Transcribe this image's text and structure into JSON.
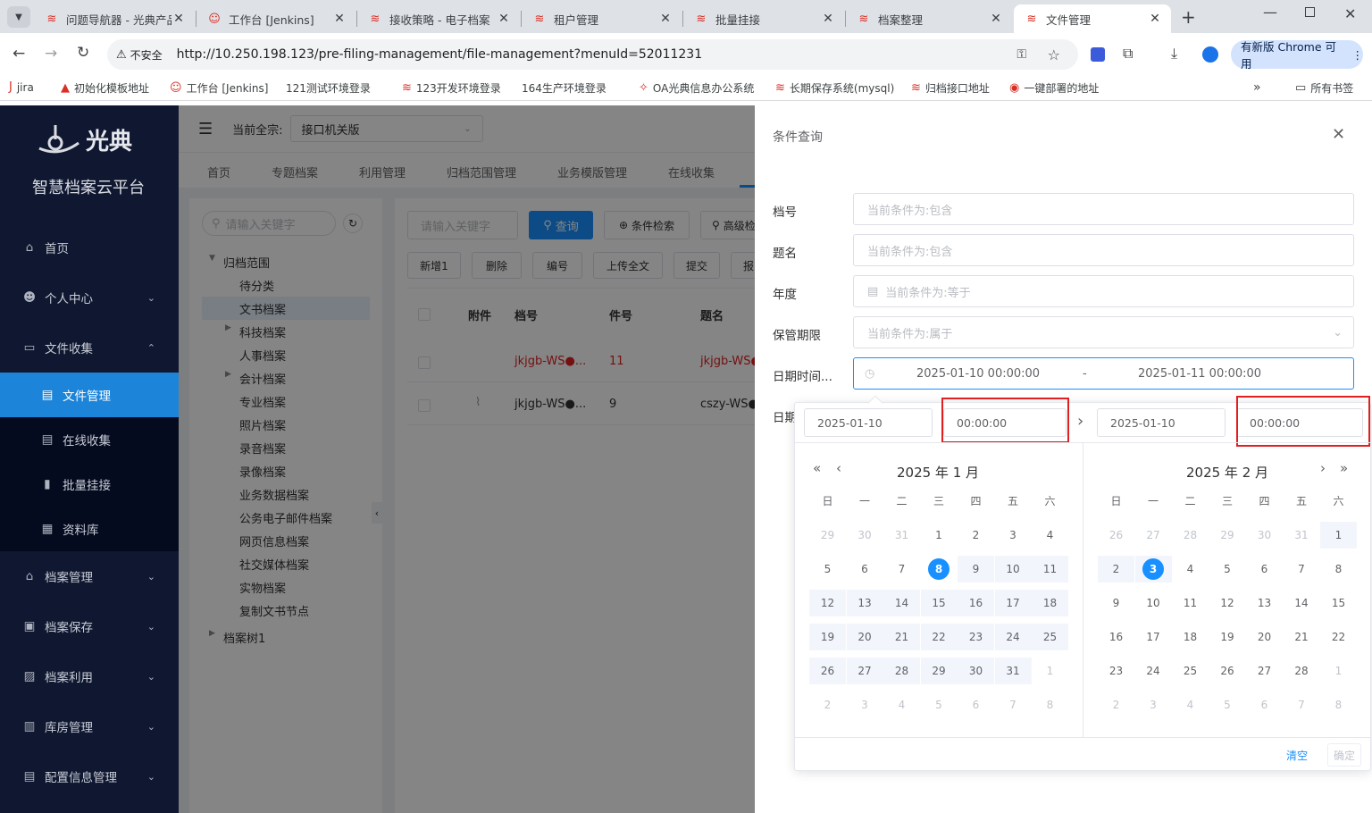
{
  "browser": {
    "tabs": [
      {
        "title": "问题导航器 - 光典产品",
        "icon": "logo-icon"
      },
      {
        "title": "工作台 [Jenkins]",
        "icon": "jenkins-icon"
      },
      {
        "title": "接收策略 - 电子档案",
        "icon": "logo-icon"
      },
      {
        "title": "租户管理",
        "icon": "logo-icon"
      },
      {
        "title": "批量挂接",
        "icon": "logo-icon"
      },
      {
        "title": "档案整理",
        "icon": "logo-icon"
      },
      {
        "title": "文件管理",
        "icon": "logo-icon"
      }
    ],
    "security": "不安全",
    "url": "http://10.250.198.123/pre-filing-management/file-management?menuId=52011231",
    "update": "有新版 Chrome 可用",
    "bookmarks": [
      "jira",
      "初始化模板地址",
      "工作台 [Jenkins]",
      "121测试环境登录",
      "123开发环境登录",
      "164生产环境登录",
      "OA光典信息办公系统",
      "长期保存系统(mysql)",
      "归档接口地址",
      "一键部署的地址"
    ],
    "all_bookmarks": "所有书签"
  },
  "app": {
    "brand": "光典",
    "platform": "智慧档案云平台",
    "menu": [
      {
        "label": "首页",
        "icon": "home-icon"
      },
      {
        "label": "个人中心",
        "icon": "user-icon"
      },
      {
        "label": "文件收集",
        "icon": "folder-icon"
      },
      {
        "label": "文件管理",
        "icon": "file-icon"
      },
      {
        "label": "在线收集",
        "icon": "document-icon"
      },
      {
        "label": "批量挂接",
        "icon": "chart-icon"
      },
      {
        "label": "资料库",
        "icon": "calendar-icon"
      },
      {
        "label": "档案管理",
        "icon": "bank-icon"
      },
      {
        "label": "档案保存",
        "icon": "save-icon"
      },
      {
        "label": "档案利用",
        "icon": "clipboard-icon"
      },
      {
        "label": "库房管理",
        "icon": "building-icon"
      },
      {
        "label": "配置信息管理",
        "icon": "config-icon"
      }
    ],
    "fonds_label": "当前全宗:",
    "fonds_value": "接口机关版",
    "nav_tabs": [
      "首页",
      "专题档案",
      "利用管理",
      "归档范围管理",
      "业务模版管理",
      "在线收集"
    ],
    "tree_search": "请输入关键字",
    "tree": [
      "归档范围",
      "待分类",
      "文书档案",
      "科技档案",
      "人事档案",
      "会计档案",
      "专业档案",
      "照片档案",
      "录音档案",
      "录像档案",
      "业务数据档案",
      "公务电子邮件档案",
      "网页信息档案",
      "社交媒体档案",
      "实物档案",
      "复制文书节点",
      "档案树1"
    ],
    "search_placeholder": "请输入关键字",
    "btn_query": "查询",
    "btn_cond": "条件检索",
    "btn_adv": "高级检",
    "actions": [
      "新增1",
      "删除",
      "编号",
      "上传全文",
      "提交",
      "报"
    ],
    "columns": [
      "附件",
      "档号",
      "件号",
      "题名"
    ],
    "rows": [
      [
        "",
        "jkjgb-WS●...",
        "11",
        "jkjgb-WS●"
      ],
      [
        "",
        "jkjgb-WS●...",
        "9",
        "cszy-WS●"
      ]
    ]
  },
  "drawer": {
    "title": "条件查询",
    "fields": [
      {
        "label": "档号",
        "placeholder": "当前条件为:包含"
      },
      {
        "label": "题名",
        "placeholder": "当前条件为:包含"
      },
      {
        "label": "年度",
        "placeholder": "当前条件为:等于"
      },
      {
        "label": "保管期限",
        "placeholder": "当前条件为:属于"
      }
    ],
    "date_label": "日期时间...",
    "date_label2": "日期",
    "range_start": "2025-01-10 00:00:00",
    "range_sep": "-",
    "range_end": "2025-01-11 00:00:00"
  },
  "picker": {
    "start_date": "2025-01-10",
    "start_time": "00:00:00",
    "end_date": "2025-01-10",
    "end_time": "00:00:00",
    "left_title": "2025 年 1 月",
    "right_title": "2025 年 2 月",
    "weekdays": [
      "日",
      "一",
      "二",
      "三",
      "四",
      "五",
      "六"
    ],
    "left_days": [
      "29",
      "30",
      "31",
      "1",
      "2",
      "3",
      "4",
      "5",
      "6",
      "7",
      "8",
      "9",
      "10",
      "11",
      "12",
      "13",
      "14",
      "15",
      "16",
      "17",
      "18",
      "19",
      "20",
      "21",
      "22",
      "23",
      "24",
      "25",
      "26",
      "27",
      "28",
      "29",
      "30",
      "31",
      "1",
      "2",
      "3",
      "4",
      "5",
      "6",
      "7",
      "8"
    ],
    "right_days": [
      "26",
      "27",
      "28",
      "29",
      "30",
      "31",
      "1",
      "2",
      "3",
      "4",
      "5",
      "6",
      "7",
      "8",
      "9",
      "10",
      "11",
      "12",
      "13",
      "14",
      "15",
      "16",
      "17",
      "18",
      "19",
      "20",
      "21",
      "22",
      "23",
      "24",
      "25",
      "26",
      "27",
      "28",
      "1",
      "2",
      "3",
      "4",
      "5",
      "6",
      "7",
      "8"
    ],
    "clear": "清空",
    "confirm": "确定"
  }
}
